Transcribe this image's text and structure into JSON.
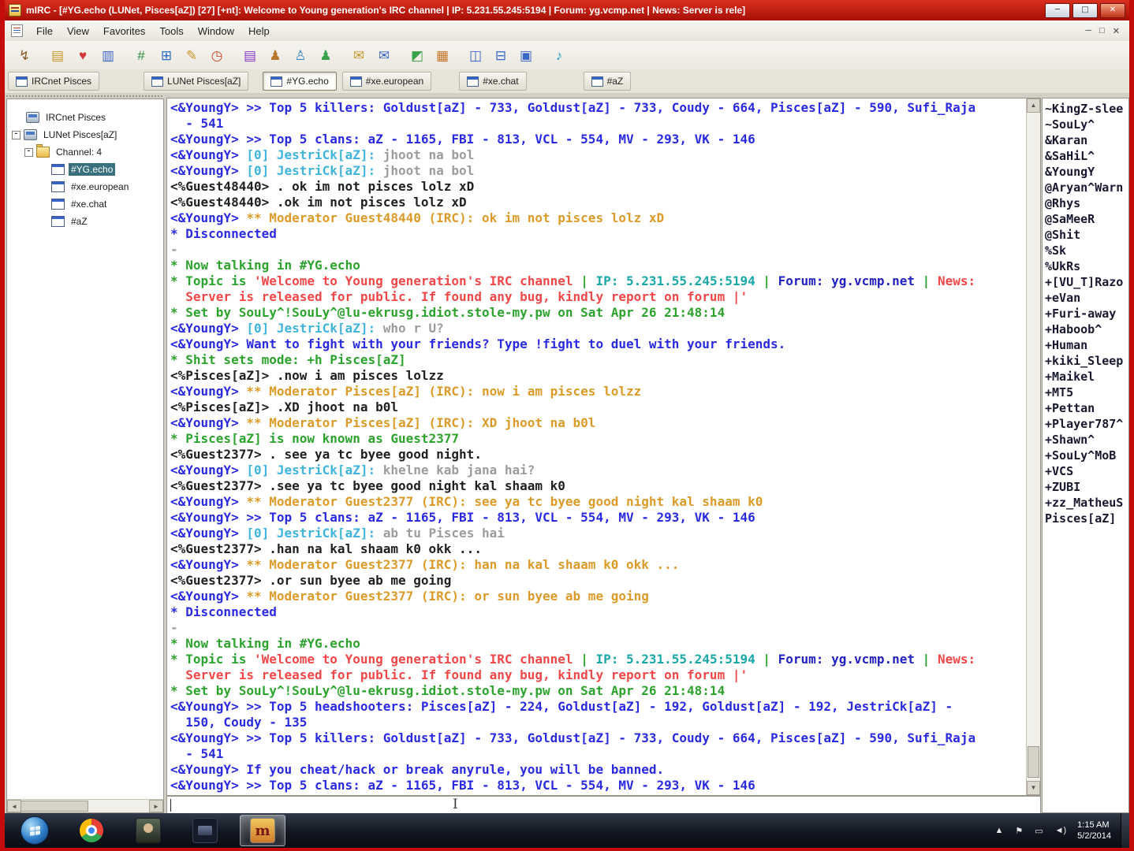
{
  "colors": {
    "blue": "#2a2ae0",
    "cyan": "#3fb4dc",
    "gray": "#9c9c9c",
    "black": "#202020",
    "orange": "#dc9b28",
    "green": "#2ca32c",
    "red": "#f04848",
    "teal": "#18a8a8",
    "navy": "#2222c0"
  },
  "glyphs": {
    "up": "▲",
    "down": "▼",
    "left": "◄",
    "right": "►",
    "expander": "-",
    "ibeam": "I"
  },
  "window": {
    "title": "mIRC - [#YG.echo (LUNet, Pisces[aZ]) [27] [+nt]: Welcome to Young generation's IRC channel | IP: 5.231.55.245:5194 | Forum: yg.vcmp.net | News: Server is rele]",
    "controls": [
      {
        "name": "minimize-button",
        "glyph": "─",
        "close": false
      },
      {
        "name": "restore-button",
        "glyph": "□",
        "close": false
      },
      {
        "name": "close-button",
        "glyph": "✕",
        "close": true
      }
    ]
  },
  "menubar": {
    "items": [
      "File",
      "View",
      "Favorites",
      "Tools",
      "Window",
      "Help"
    ],
    "mdi_controls": [
      {
        "name": "mdi-minimize-button",
        "glyph": "─"
      },
      {
        "name": "mdi-restore-button",
        "glyph": "□"
      },
      {
        "name": "mdi-close-button",
        "glyph": "✕"
      }
    ]
  },
  "toolbar": {
    "icons": [
      {
        "name": "connect-icon",
        "glyph": "↯",
        "color": "#8a5a28",
        "gap": 0
      },
      {
        "name": "options-folder-icon",
        "glyph": "▤",
        "color": "#c8982a",
        "gap": 10
      },
      {
        "name": "favorites-icon",
        "glyph": "♥",
        "color": "#d23a3a",
        "gap": 0
      },
      {
        "name": "clipboard-icon",
        "glyph": "▥",
        "color": "#3a66c8",
        "gap": 0
      },
      {
        "name": "channels-list-icon",
        "glyph": "#",
        "color": "#2a8a3a",
        "gap": 10
      },
      {
        "name": "monitor-icon",
        "glyph": "⊞",
        "color": "#2a6ac8",
        "gap": 0
      },
      {
        "name": "scripts-editor-icon",
        "glyph": "✎",
        "color": "#c8982a",
        "gap": 0
      },
      {
        "name": "timer-icon",
        "glyph": "◷",
        "color": "#c84a2a",
        "gap": 0
      },
      {
        "name": "address-book-icon",
        "glyph": "▤",
        "color": "#8a3ac8",
        "gap": 10
      },
      {
        "name": "users-icon",
        "glyph": "♟",
        "color": "#b8762a",
        "gap": 0
      },
      {
        "name": "user-add-icon",
        "glyph": "♙",
        "color": "#3a8ac8",
        "gap": 0
      },
      {
        "name": "notify-list-icon",
        "glyph": "♟",
        "color": "#3aa04a",
        "gap": 0
      },
      {
        "name": "dcc-send-icon",
        "glyph": "✉",
        "color": "#c8982a",
        "gap": 10
      },
      {
        "name": "dcc-get-icon",
        "glyph": "✉",
        "color": "#3a66c8",
        "gap": 0
      },
      {
        "name": "colors-icon",
        "glyph": "◩",
        "color": "#3aa04a",
        "gap": 10
      },
      {
        "name": "font-icon",
        "glyph": "▦",
        "color": "#c8762a",
        "gap": 0
      },
      {
        "name": "tile-windows-icon",
        "glyph": "◫",
        "color": "#3a66c8",
        "gap": 10
      },
      {
        "name": "stack-windows-icon",
        "glyph": "⊟",
        "color": "#3a66c8",
        "gap": 0
      },
      {
        "name": "cascade-windows-icon",
        "glyph": "▣",
        "color": "#3a66c8",
        "gap": 0
      },
      {
        "name": "sounds-icon",
        "glyph": "♪",
        "color": "#2a9ac8",
        "gap": 10
      }
    ]
  },
  "switchbar": {
    "tabs": [
      {
        "label": "IRCnet Pisces",
        "active": false,
        "gap": 4
      },
      {
        "label": "LUNet Pisces[aZ]",
        "active": false,
        "gap": 56
      },
      {
        "label": "#YG.echo",
        "active": true,
        "gap": 18
      },
      {
        "label": "#xe.european",
        "active": false,
        "gap": 7
      },
      {
        "label": "#xe.chat",
        "active": false,
        "gap": 35
      },
      {
        "label": "#aZ",
        "active": false,
        "gap": 72
      }
    ]
  },
  "tree": {
    "items": [
      {
        "label": "IRCnet Pisces",
        "indent": 24,
        "expander": false,
        "icon": "server",
        "selected": false
      },
      {
        "label": "LUNet Pisces[aZ]",
        "indent": 6,
        "expander": true,
        "icon": "server",
        "selected": false
      },
      {
        "label": "Channel: 4",
        "indent": 22,
        "expander": true,
        "icon": "folder",
        "selected": false
      },
      {
        "label": "#YG.echo",
        "indent": 56,
        "expander": false,
        "icon": "channel",
        "selected": true
      },
      {
        "label": "#xe.european",
        "indent": 56,
        "expander": false,
        "icon": "channel",
        "selected": false
      },
      {
        "label": "#xe.chat",
        "indent": 56,
        "expander": false,
        "icon": "channel",
        "selected": false
      },
      {
        "label": "#aZ",
        "indent": 56,
        "expander": false,
        "icon": "channel",
        "selected": false
      }
    ]
  },
  "chat": {
    "lines": [
      [
        [
          "<&YoungY> >> Top 5 killers: Goldust[aZ] - 733, Goldust[aZ] - 733, Coudy - 664, Pisces[aZ] - 590, Sufi_Raja",
          "blue"
        ]
      ],
      [
        [
          "  - 541",
          "blue"
        ]
      ],
      [
        [
          "<&YoungY> >> Top 5 clans: aZ - 1165, FBI - 813, VCL - 554, MV - 293, VK - 146",
          "blue"
        ]
      ],
      [
        [
          "<&YoungY> ",
          "blue"
        ],
        [
          "[0] JestriCk[aZ]:",
          "cyan"
        ],
        [
          " jhoot na bol",
          "gray"
        ]
      ],
      [
        [
          "<&YoungY> ",
          "blue"
        ],
        [
          "[0] JestriCk[aZ]:",
          "cyan"
        ],
        [
          " jhoot na bol",
          "gray"
        ]
      ],
      [
        [
          "<%Guest48440> . ok im not pisces lolz xD",
          "black"
        ]
      ],
      [
        [
          "<%Guest48440> .ok im not pisces lolz xD",
          "black"
        ]
      ],
      [
        [
          "<&YoungY> ",
          "blue"
        ],
        [
          "** Moderator Guest48440 (IRC): ok im not pisces lolz xD",
          "orange"
        ]
      ],
      [
        [
          "* Disconnected",
          "blue"
        ]
      ],
      [
        [
          "-",
          "gray"
        ]
      ],
      [
        [
          "* Now talking in #YG.echo",
          "green"
        ]
      ],
      [
        [
          "* Topic is ",
          "green"
        ],
        [
          "'Welcome to Young generation's IRC channel ",
          "red"
        ],
        [
          "| ",
          "green"
        ],
        [
          "IP: 5.231.55.245:5194 ",
          "teal"
        ],
        [
          "| ",
          "green"
        ],
        [
          "Forum: yg.vcmp.net ",
          "navy"
        ],
        [
          "| ",
          "green"
        ],
        [
          "News:",
          "red"
        ]
      ],
      [
        [
          "  Server is released for public. If found any bug, kindly report on forum |'",
          "red"
        ]
      ],
      [
        [
          "* Set by SouLy^!SouLy^@lu-ekrusg.idiot.stole-my.pw on Sat Apr 26 21:48:14",
          "green"
        ]
      ],
      [
        [
          "<&YoungY> ",
          "blue"
        ],
        [
          "[0] JestriCk[aZ]:",
          "cyan"
        ],
        [
          " who r U?",
          "gray"
        ]
      ],
      [
        [
          "<&YoungY> Want to fight with your friends? Type !fight to duel with your friends.",
          "blue"
        ]
      ],
      [
        [
          "* Shit sets mode: +h Pisces[aZ]",
          "green"
        ]
      ],
      [
        [
          "<%Pisces[aZ]> .now i am pisces lolzz",
          "black"
        ]
      ],
      [
        [
          "<&YoungY> ",
          "blue"
        ],
        [
          "** Moderator Pisces[aZ] (IRC): now i am pisces lolzz",
          "orange"
        ]
      ],
      [
        [
          "<%Pisces[aZ]> .XD jhoot na b0l",
          "black"
        ]
      ],
      [
        [
          "<&YoungY> ",
          "blue"
        ],
        [
          "** Moderator Pisces[aZ] (IRC): XD jhoot na b0l",
          "orange"
        ]
      ],
      [
        [
          "* Pisces[aZ] is now known as Guest2377",
          "green"
        ]
      ],
      [
        [
          "<%Guest2377> . see ya tc byee good night.",
          "black"
        ]
      ],
      [
        [
          "<&YoungY> ",
          "blue"
        ],
        [
          "[0] JestriCk[aZ]:",
          "cyan"
        ],
        [
          " khelne kab jana hai?",
          "gray"
        ]
      ],
      [
        [
          "<%Guest2377> .see ya tc byee good night kal shaam k0",
          "black"
        ]
      ],
      [
        [
          "<&YoungY> ",
          "blue"
        ],
        [
          "** Moderator Guest2377 (IRC): see ya tc byee good night kal shaam k0",
          "orange"
        ]
      ],
      [
        [
          "<&YoungY> >> Top 5 clans: aZ - 1165, FBI - 813, VCL - 554, MV - 293, VK - 146",
          "blue"
        ]
      ],
      [
        [
          "<&YoungY> ",
          "blue"
        ],
        [
          "[0] JestriCk[aZ]:",
          "cyan"
        ],
        [
          " ab tu Pisces hai",
          "gray"
        ]
      ],
      [
        [
          "<%Guest2377> .han na kal shaam k0 okk ...",
          "black"
        ]
      ],
      [
        [
          "<&YoungY> ",
          "blue"
        ],
        [
          "** Moderator Guest2377 (IRC): han na kal shaam k0 okk ...",
          "orange"
        ]
      ],
      [
        [
          "<%Guest2377> .or sun byee ab me going",
          "black"
        ]
      ],
      [
        [
          "<&YoungY> ",
          "blue"
        ],
        [
          "** Moderator Guest2377 (IRC): or sun byee ab me going",
          "orange"
        ]
      ],
      [
        [
          "* Disconnected",
          "blue"
        ]
      ],
      [
        [
          "-",
          "gray"
        ]
      ],
      [
        [
          "* Now talking in #YG.echo",
          "green"
        ]
      ],
      [
        [
          "* Topic is ",
          "green"
        ],
        [
          "'Welcome to Young generation's IRC channel ",
          "red"
        ],
        [
          "| ",
          "green"
        ],
        [
          "IP: 5.231.55.245:5194 ",
          "teal"
        ],
        [
          "| ",
          "green"
        ],
        [
          "Forum: yg.vcmp.net ",
          "navy"
        ],
        [
          "| ",
          "green"
        ],
        [
          "News:",
          "red"
        ]
      ],
      [
        [
          "  Server is released for public. If found any bug, kindly report on forum |'",
          "red"
        ]
      ],
      [
        [
          "* Set by SouLy^!SouLy^@lu-ekrusg.idiot.stole-my.pw on Sat Apr 26 21:48:14",
          "green"
        ]
      ],
      [
        [
          "<&YoungY> >> Top 5 headshooters: Pisces[aZ] - 224, Goldust[aZ] - 192, Goldust[aZ] - 192, JestriCk[aZ] -",
          "blue"
        ]
      ],
      [
        [
          "  150, Coudy - 135",
          "blue"
        ]
      ],
      [
        [
          "<&YoungY> >> Top 5 killers: Goldust[aZ] - 733, Goldust[aZ] - 733, Coudy - 664, Pisces[aZ] - 590, Sufi_Raja",
          "blue"
        ]
      ],
      [
        [
          "  - 541",
          "blue"
        ]
      ],
      [
        [
          "<&YoungY> If you cheat/hack or break anyrule, you will be banned.",
          "blue"
        ]
      ],
      [
        [
          "<&YoungY> >> Top 5 clans: aZ - 1165, FBI - 813, VCL - 554, MV - 293, VK - 146",
          "blue"
        ]
      ]
    ]
  },
  "nicklist": {
    "nicks": [
      "~KingZ-slee",
      "~SouLy^",
      "&Karan",
      "&SaHiL^",
      "&YoungY",
      "@Aryan^Warn",
      "@Rhys",
      "@SaMeeR",
      "@Shit",
      "%Sk",
      "%UkRs",
      "+[VU_T]Razo",
      "+eVan",
      "+Furi-away",
      "+Haboob^",
      "+Human",
      "+kiki_Sleep",
      "+Maikel",
      "+MT5",
      "+Pettan",
      "+Player787^",
      "+Shawn^",
      "+SouLy^MoB",
      "+VCS",
      "+ZUBI",
      "+zz_MatheuS",
      "Pisces[aZ]"
    ]
  },
  "taskbar": {
    "clock_time": "1:15 AM",
    "clock_date": "5/2/2014",
    "mirc_glyph": "m",
    "tray": [
      {
        "name": "tray-expand-button",
        "glyph": "▲"
      },
      {
        "name": "action-center-icon",
        "glyph": "⚑"
      },
      {
        "name": "network-icon",
        "glyph": "▭"
      },
      {
        "name": "volume-icon",
        "glyph": "◄)"
      }
    ]
  }
}
